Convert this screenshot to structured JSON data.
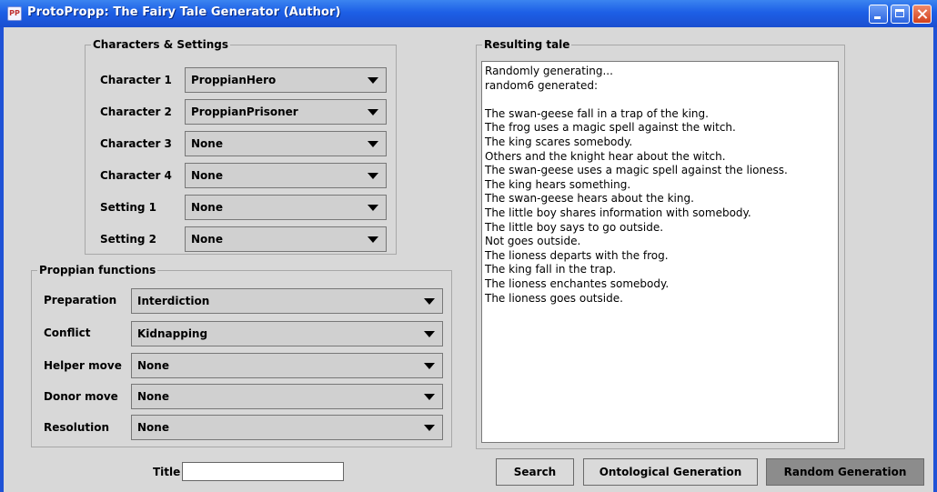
{
  "window": {
    "title": "ProtoPropp: The Fairy Tale Generator (Author)",
    "icon_text": "PP"
  },
  "characters_settings": {
    "title": "Characters & Settings",
    "rows": [
      {
        "label": "Character 1",
        "value": "ProppianHero"
      },
      {
        "label": "Character 2",
        "value": "ProppianPrisoner"
      },
      {
        "label": "Character 3",
        "value": "None"
      },
      {
        "label": "Character 4",
        "value": "None"
      },
      {
        "label": "Setting 1",
        "value": "None"
      },
      {
        "label": "Setting 2",
        "value": "None"
      }
    ]
  },
  "proppian_functions": {
    "title": "Proppian functions",
    "rows": [
      {
        "label": "Preparation",
        "value": "Interdiction"
      },
      {
        "label": "Conflict",
        "value": "Kidnapping"
      },
      {
        "label": "Helper move",
        "value": "None"
      },
      {
        "label": "Donor move",
        "value": "None"
      },
      {
        "label": "Resolution",
        "value": "None"
      }
    ]
  },
  "resulting_tale": {
    "title": "Resulting tale",
    "lines": [
      "Randomly generating...",
      "random6 generated:",
      "",
      "The swan-geese fall in a trap of the king.",
      "The frog uses a magic spell against the witch.",
      "The king scares somebody.",
      "Others and the knight hear about the witch.",
      "The swan-geese uses a magic spell against the lioness.",
      "The king hears something.",
      "The swan-geese hears about the king.",
      "The little boy shares information with somebody.",
      "The little boy says to go outside.",
      "Not goes outside.",
      "The lioness departs with the frog.",
      "The king fall in the trap.",
      "The lioness enchantes somebody.",
      "The lioness goes outside."
    ]
  },
  "title_field": {
    "label": "Title",
    "value": ""
  },
  "buttons": {
    "search": "Search",
    "ontological": "Ontological Generation",
    "random": "Random Generation"
  }
}
